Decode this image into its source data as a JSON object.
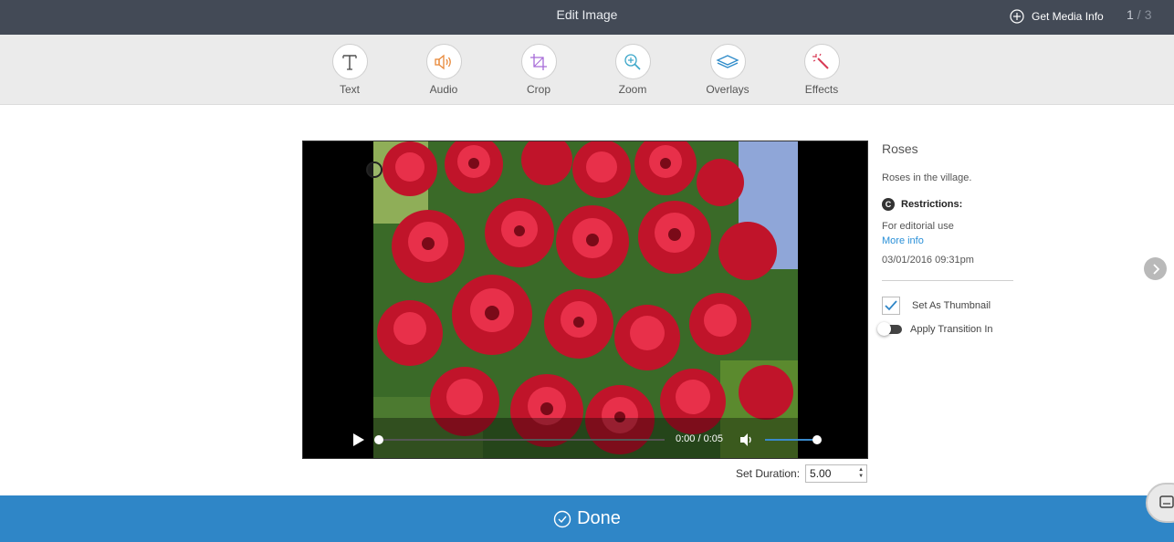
{
  "header": {
    "title": "Edit Image",
    "media_info_label": "Get Media Info",
    "page_current": "1",
    "page_separator": "/",
    "page_total": "3"
  },
  "toolbar": {
    "tools": [
      {
        "label": "Text",
        "icon": "text-icon"
      },
      {
        "label": "Audio",
        "icon": "audio-icon"
      },
      {
        "label": "Crop",
        "icon": "crop-icon"
      },
      {
        "label": "Zoom",
        "icon": "zoom-icon"
      },
      {
        "label": "Overlays",
        "icon": "overlays-icon"
      },
      {
        "label": "Effects",
        "icon": "effects-icon"
      }
    ]
  },
  "player": {
    "time": "0:00 / 0:05",
    "progress": 0,
    "volume": 1
  },
  "panel": {
    "title": "Roses",
    "description": "Roses in the village.",
    "restrictions_label": "Restrictions:",
    "restrictions_icon": "C",
    "restriction_text": "For editorial use",
    "more_info": "More info",
    "date": "03/01/2016 09:31pm",
    "thumbnail_label": "Set As Thumbnail",
    "thumbnail_checked": true,
    "transition_label": "Apply Transition In",
    "transition_on": false
  },
  "duration": {
    "label": "Set Duration:",
    "value": "5.00"
  },
  "footer": {
    "done_label": "Done"
  },
  "colors": {
    "header_bg": "#434a56",
    "accent": "#2f86c7",
    "link": "#2a90d8"
  }
}
